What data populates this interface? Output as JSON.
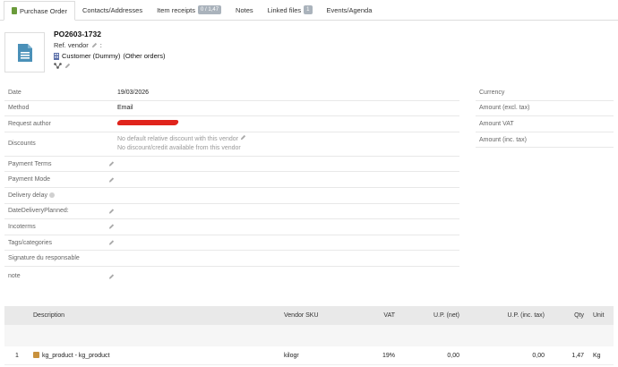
{
  "tabs": [
    {
      "label": "Purchase Order",
      "active": true,
      "icon": "order-icon"
    },
    {
      "label": "Contacts/Addresses"
    },
    {
      "label": "Item receipts",
      "badge": "0 / 1,47"
    },
    {
      "label": "Notes"
    },
    {
      "label": "Linked files",
      "badge": "1"
    },
    {
      "label": "Events/Agenda"
    }
  ],
  "banner": {
    "ref": "PO2603-1732",
    "ref_vendor_label": "Ref. vendor",
    "ref_vendor_sep": ":",
    "thirdparty_name": "Customer (Dummy)",
    "other_orders": "(Other orders)"
  },
  "fields": {
    "date_label": "Date",
    "date_value": "19/03/2026",
    "method_label": "Method",
    "method_value": "Email",
    "request_author_label": "Request author",
    "discounts_label": "Discounts",
    "discounts_line1": "No default relative discount with this vendor",
    "discounts_line2": "No discount/credit available from this vendor",
    "payment_terms_label": "Payment Terms",
    "payment_mode_label": "Payment Mode",
    "delivery_delay_label": "Delivery delay",
    "date_delivery_label": "DateDeliveryPlanned:",
    "incoterms_label": "Incoterms",
    "tags_label": "Tags/categories",
    "signature_label": "Signature du responsable",
    "note_label": "note"
  },
  "amounts": {
    "currency_label": "Currency",
    "excl_label": "Amount (excl. tax)",
    "vat_label": "Amount VAT",
    "inc_label": "Amount (inc. tax)"
  },
  "lines": {
    "headers": {
      "description": "Description",
      "vendor_sku": "Vendor SKU",
      "vat": "VAT",
      "up_net": "U.P. (net)",
      "up_inc": "U.P. (inc. tax)",
      "qty": "Qty",
      "unit": "Unit"
    },
    "rows": [
      {
        "num": "1",
        "description": "kg_product - kg_product",
        "vendor_sku": "kilogr",
        "vat": "19%",
        "up_net": "0,00",
        "up_inc": "0,00",
        "qty": "1,47",
        "unit": "Kg"
      }
    ]
  },
  "colors": {
    "accent_logo": "#4a90b8",
    "redaction": "#e0241c",
    "badge": "#aab3bc"
  }
}
